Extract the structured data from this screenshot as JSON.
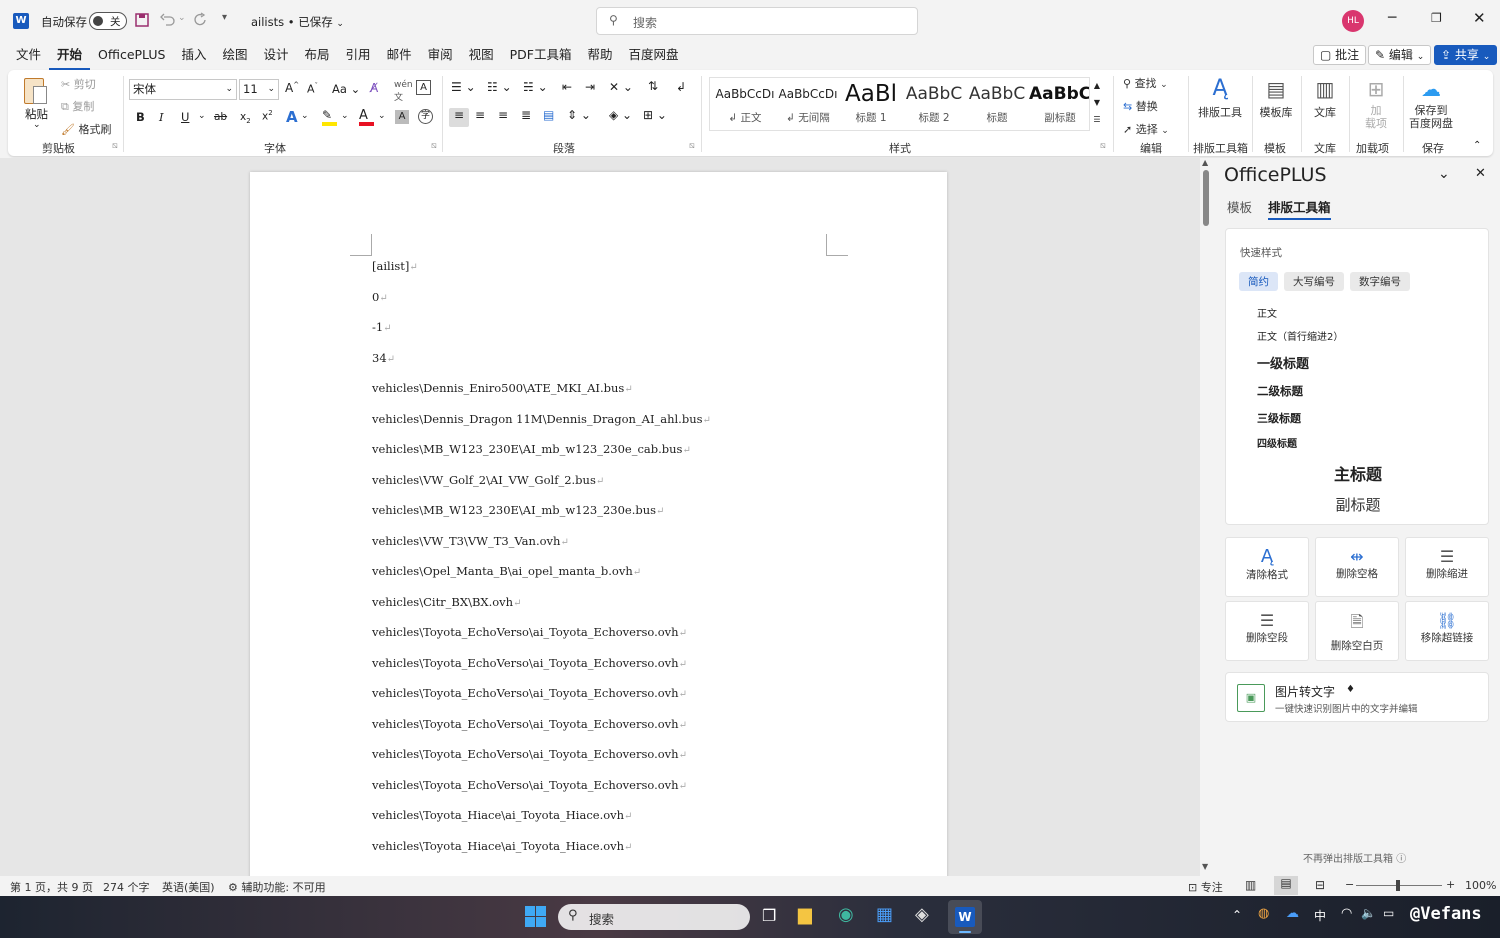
{
  "titlebar": {
    "autosave_label": "自动保存",
    "autosave_state": "关",
    "doc_title": "ailists • 已保存",
    "search_placeholder": "搜索",
    "user_initials": "HL"
  },
  "menu": [
    "文件",
    "开始",
    "OfficePLUS",
    "插入",
    "绘图",
    "设计",
    "布局",
    "引用",
    "邮件",
    "审阅",
    "视图",
    "PDF工具箱",
    "帮助",
    "百度网盘"
  ],
  "menu_right": {
    "comment": "批注",
    "edit": "编辑",
    "share": "共享"
  },
  "ribbon": {
    "clipboard": {
      "paste": "粘贴",
      "cut": "剪切",
      "copy": "复制",
      "format_painter": "格式刷",
      "label": "剪贴板"
    },
    "font": {
      "name": "宋体",
      "size": "11",
      "label": "字体",
      "bold": "B",
      "italic": "I",
      "underline": "U"
    },
    "paragraph": {
      "label": "段落"
    },
    "styles": {
      "label": "样式",
      "items": [
        {
          "preview": "AaBbCcDı",
          "name": "↲ 正文"
        },
        {
          "preview": "AaBbCcDı",
          "name": "↲ 无间隔"
        },
        {
          "preview": "AaBl",
          "name": "标题 1"
        },
        {
          "preview": "AaBbC",
          "name": "标题 2"
        },
        {
          "preview": "AaBbC",
          "name": "标题"
        },
        {
          "preview": "AaBbC",
          "name": "副标题"
        }
      ]
    },
    "editing": {
      "find": "查找",
      "replace": "替换",
      "select": "选择",
      "label": "编辑"
    },
    "layout_tools": {
      "btn": "排版工具",
      "label": "排版工具箱"
    },
    "templates": {
      "btn": "模板库",
      "label": "模板"
    },
    "library": {
      "btn": "文库",
      "label": "文库"
    },
    "addins": {
      "btn1": "加",
      "btn2": "载项",
      "label": "加载项"
    },
    "save": {
      "btn1": "保存到",
      "btn2": "百度网盘",
      "label": "保存"
    }
  },
  "document": {
    "lines": [
      "[ailist]",
      "0",
      "-1",
      "34",
      "vehicles\\Dennis_Eniro500\\ATE_MKI_AI.bus",
      "vehicles\\Dennis_Dragon 11M\\Dennis_Dragon_AI_ahl.bus",
      "vehicles\\MB_W123_230E\\AI_mb_w123_230e_cab.bus",
      "vehicles\\VW_Golf_2\\AI_VW_Golf_2.bus",
      "vehicles\\MB_W123_230E\\AI_mb_w123_230e.bus",
      "vehicles\\VW_T3\\VW_T3_Van.ovh",
      "vehicles\\Opel_Manta_B\\ai_opel_manta_b.ovh",
      "vehicles\\Citr_BX\\BX.ovh",
      "vehicles\\Toyota_EchoVerso\\ai_Toyota_Echoverso.ovh",
      "vehicles\\Toyota_EchoVerso\\ai_Toyota_Echoverso.ovh",
      "vehicles\\Toyota_EchoVerso\\ai_Toyota_Echoverso.ovh",
      "vehicles\\Toyota_EchoVerso\\ai_Toyota_Echoverso.ovh",
      "vehicles\\Toyota_EchoVerso\\ai_Toyota_Echoverso.ovh",
      "vehicles\\Toyota_EchoVerso\\ai_Toyota_Echoverso.ovh",
      "vehicles\\Toyota_Hiace\\ai_Toyota_Hiace.ovh",
      "vehicles\\Toyota_Hiace\\ai_Toyota_Hiace.ovh"
    ],
    "mark": "↵"
  },
  "pane": {
    "title": "OfficePLUS",
    "tabs": [
      "模板",
      "排版工具箱"
    ],
    "quick_style_label": "快速样式",
    "chips": [
      "简约",
      "大写编号",
      "数字编号"
    ],
    "styles": [
      "正文",
      "正文（首行缩进2）",
      "一级标题",
      "二级标题",
      "三级标题",
      "四级标题",
      "主标题",
      "副标题"
    ],
    "tools": [
      "清除格式",
      "删除空格",
      "删除缩进",
      "删除空段",
      "删除空白页",
      "移除超链接"
    ],
    "ocr_title": "图片转文字",
    "ocr_desc": "一键快速识别图片中的文字并编辑",
    "footer": "不再弹出排版工具箱"
  },
  "status": {
    "page": "第 1 页，共 9 页",
    "words": "274 个字",
    "lang": "英语(美国)",
    "a11y": "辅助功能: 不可用",
    "focus": "专注",
    "zoom": "100%"
  },
  "taskbar": {
    "search": "搜索",
    "ime": "中",
    "watermark": "@Vefans"
  }
}
